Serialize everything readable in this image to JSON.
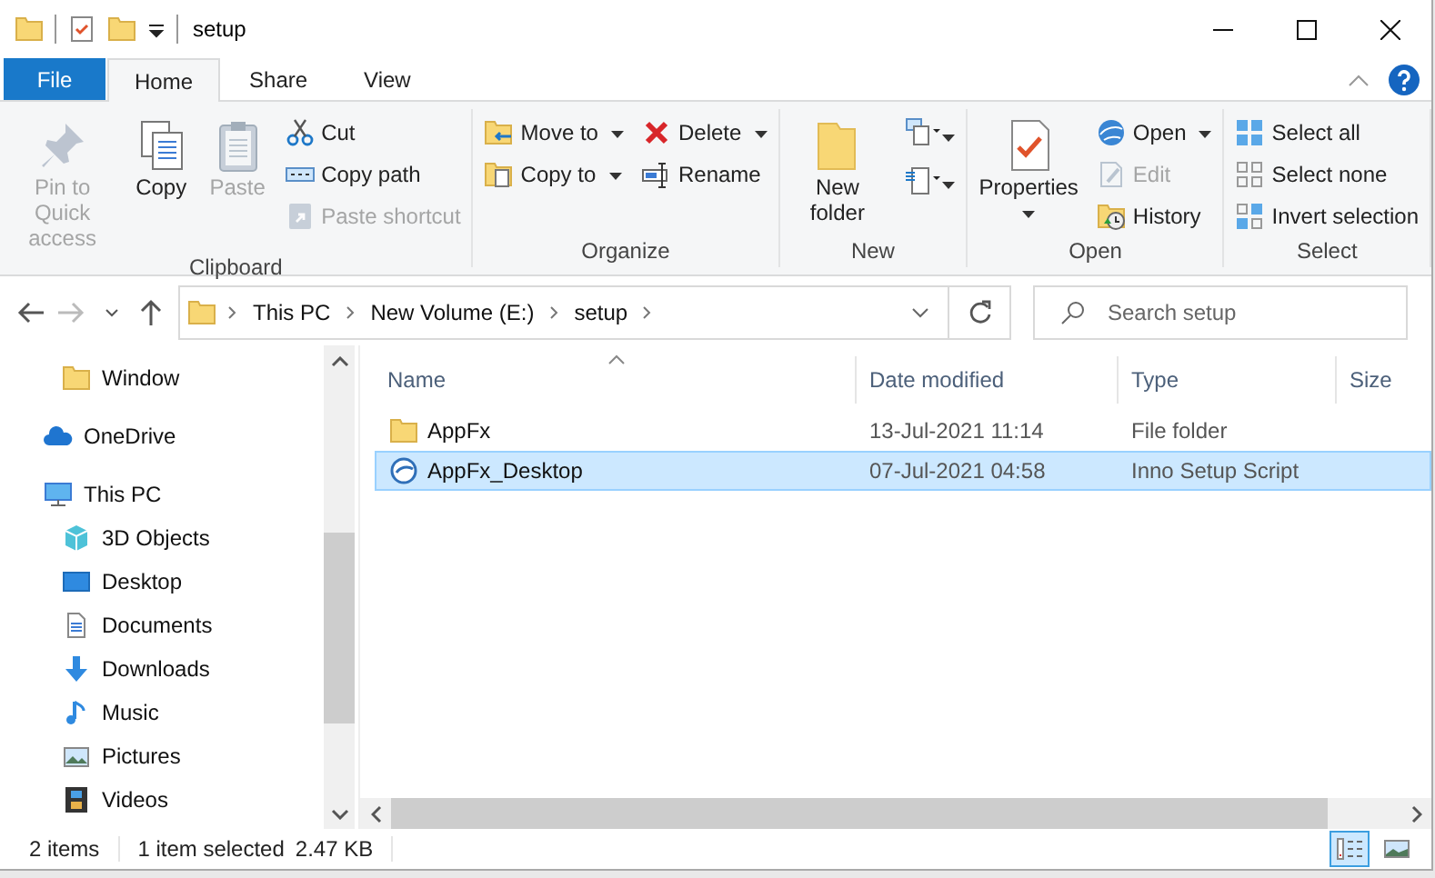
{
  "window": {
    "title": "setup"
  },
  "tabs": [
    {
      "label": "File",
      "kind": "file",
      "selected": false
    },
    {
      "label": "Home",
      "kind": "tab",
      "selected": true
    },
    {
      "label": "Share",
      "kind": "tab",
      "selected": false
    },
    {
      "label": "View",
      "kind": "tab",
      "selected": false
    }
  ],
  "ribbon": {
    "groups": [
      {
        "label": "Clipboard",
        "columns": [
          [
            {
              "label": "Pin to Quick access",
              "kind": "large",
              "disabled": true,
              "dropdown": false
            }
          ],
          [
            {
              "label": "Copy",
              "kind": "large",
              "disabled": false,
              "dropdown": false
            }
          ],
          [
            {
              "label": "Paste",
              "kind": "large",
              "disabled": true,
              "dropdown": false
            }
          ],
          [
            {
              "label": "Cut",
              "kind": "small",
              "disabled": false,
              "dropdown": false
            },
            {
              "label": "Copy path",
              "kind": "small",
              "disabled": false,
              "dropdown": false
            },
            {
              "label": "Paste shortcut",
              "kind": "small",
              "disabled": true,
              "dropdown": false
            }
          ]
        ]
      },
      {
        "label": "Organize",
        "columns": [
          [
            {
              "label": "Move to",
              "kind": "small",
              "disabled": false,
              "dropdown": true
            },
            {
              "label": "Copy to",
              "kind": "small",
              "disabled": false,
              "dropdown": true
            }
          ],
          [
            {
              "label": "Delete",
              "kind": "small",
              "disabled": false,
              "dropdown": true
            },
            {
              "label": "Rename",
              "kind": "small",
              "disabled": false,
              "dropdown": false
            }
          ]
        ]
      },
      {
        "label": "New",
        "columns": [
          [
            {
              "label": "New folder",
              "kind": "large",
              "disabled": false,
              "dropdown": false
            }
          ],
          [
            {
              "kind": "icon",
              "disabled": false,
              "dropdown": true
            },
            {
              "kind": "icon",
              "disabled": false,
              "dropdown": true
            }
          ]
        ]
      },
      {
        "label": "Open",
        "columns": [
          [
            {
              "label": "Properties",
              "kind": "large",
              "disabled": false,
              "dropdown": true
            }
          ],
          [
            {
              "label": "Open",
              "kind": "small",
              "disabled": false,
              "dropdown": true
            },
            {
              "label": "Edit",
              "kind": "small",
              "disabled": true,
              "dropdown": false
            },
            {
              "label": "History",
              "kind": "small",
              "disabled": false,
              "dropdown": false
            }
          ]
        ]
      },
      {
        "label": "Select",
        "columns": [
          [
            {
              "label": "Select all",
              "kind": "small",
              "disabled": false,
              "dropdown": false
            },
            {
              "label": "Select none",
              "kind": "small",
              "disabled": false,
              "dropdown": false
            },
            {
              "label": "Invert selection",
              "kind": "small",
              "disabled": false,
              "dropdown": false
            }
          ]
        ]
      }
    ]
  },
  "navigation": {
    "back_disabled": false,
    "forward_disabled": true,
    "up_disabled": false
  },
  "address": {
    "breadcrumb": [
      "This PC",
      "New Volume (E:)",
      "setup"
    ]
  },
  "search": {
    "placeholder": "Search setup"
  },
  "sidebar": {
    "items": [
      {
        "children": [
          {
            "label": "Window"
          }
        ]
      },
      {
        "label": "OneDrive"
      },
      {
        "label": "This PC",
        "children": [
          {
            "label": "3D Objects"
          },
          {
            "label": "Desktop"
          },
          {
            "label": "Documents"
          },
          {
            "label": "Downloads"
          },
          {
            "label": "Music"
          },
          {
            "label": "Pictures"
          },
          {
            "label": "Videos"
          }
        ]
      }
    ]
  },
  "table": {
    "columns": [
      "Name",
      "Date modified",
      "Type",
      "Size"
    ],
    "rows": [
      {
        "kind": "folder",
        "name": "AppFx",
        "date": "13-Jul-2021 11:14",
        "type": "File folder",
        "selected": false
      },
      {
        "kind": "script",
        "name": "AppFx_Desktop",
        "date": "07-Jul-2021 04:58",
        "type": "Inno Setup Script",
        "selected": true
      }
    ]
  },
  "status_bar": {
    "items": [
      "2 items",
      "1 item selected",
      "2.47 KB"
    ]
  },
  "views": [
    {
      "kind": "details",
      "selected": true
    },
    {
      "kind": "large-icons",
      "selected": false
    }
  ]
}
